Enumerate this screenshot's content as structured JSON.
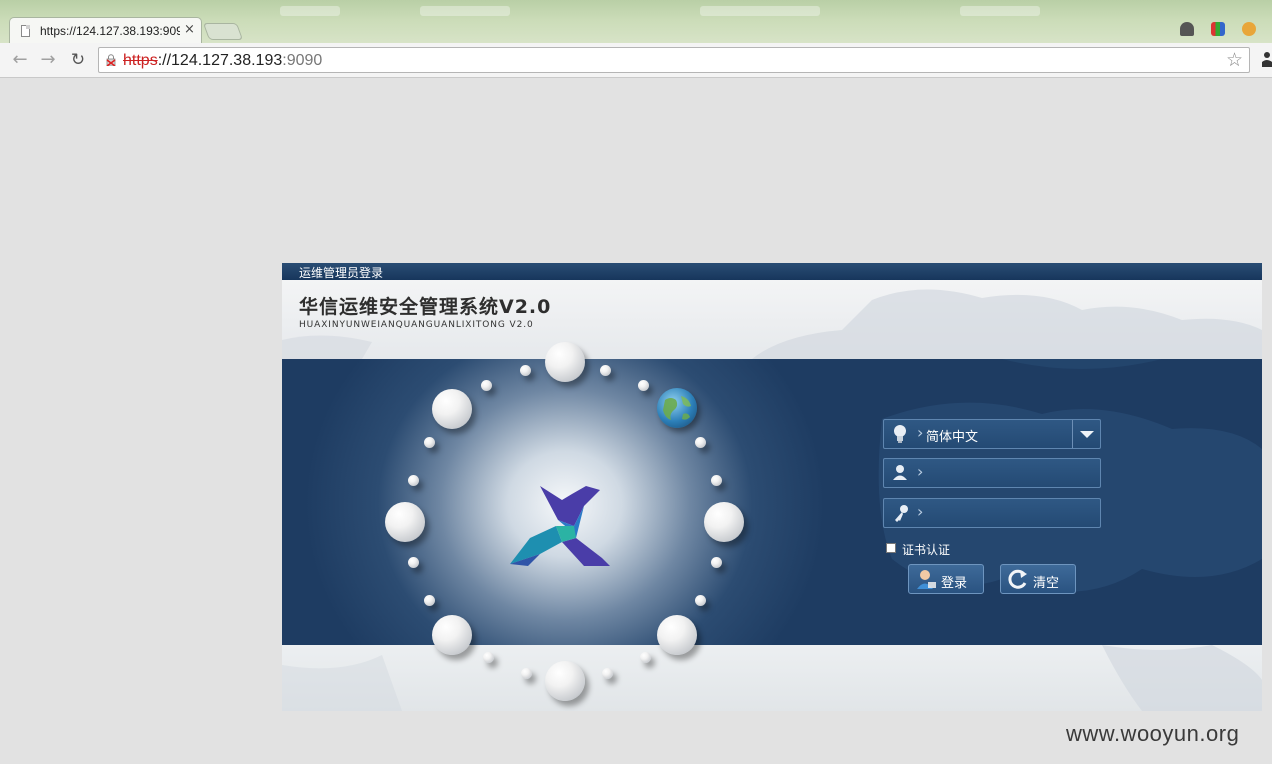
{
  "browser": {
    "tab_title": "https://124.127.38.193:9090",
    "url_scheme": "https",
    "url_host": "://124.127.38.193",
    "url_port": ":9090"
  },
  "card": {
    "header": "运维管理员登录",
    "product_title": "华信运维安全管理系统V2.0",
    "product_subtitle": "HUAXINYUNWEIANQUANGUANLIXITONG V2.0"
  },
  "login_form": {
    "language_value": "简体中文",
    "username_value": "",
    "password_value": "",
    "cert_checkbox_label": "证书认证",
    "cert_checked": false,
    "login_button": "登录",
    "clear_button": "清空"
  },
  "watermark": "www.wooyun.org",
  "colors": {
    "header_bar": "#1c3b60",
    "panel_dark": "#1e3c62",
    "field_bg": "#2a5079",
    "insecure_scheme": "#cc2222"
  }
}
